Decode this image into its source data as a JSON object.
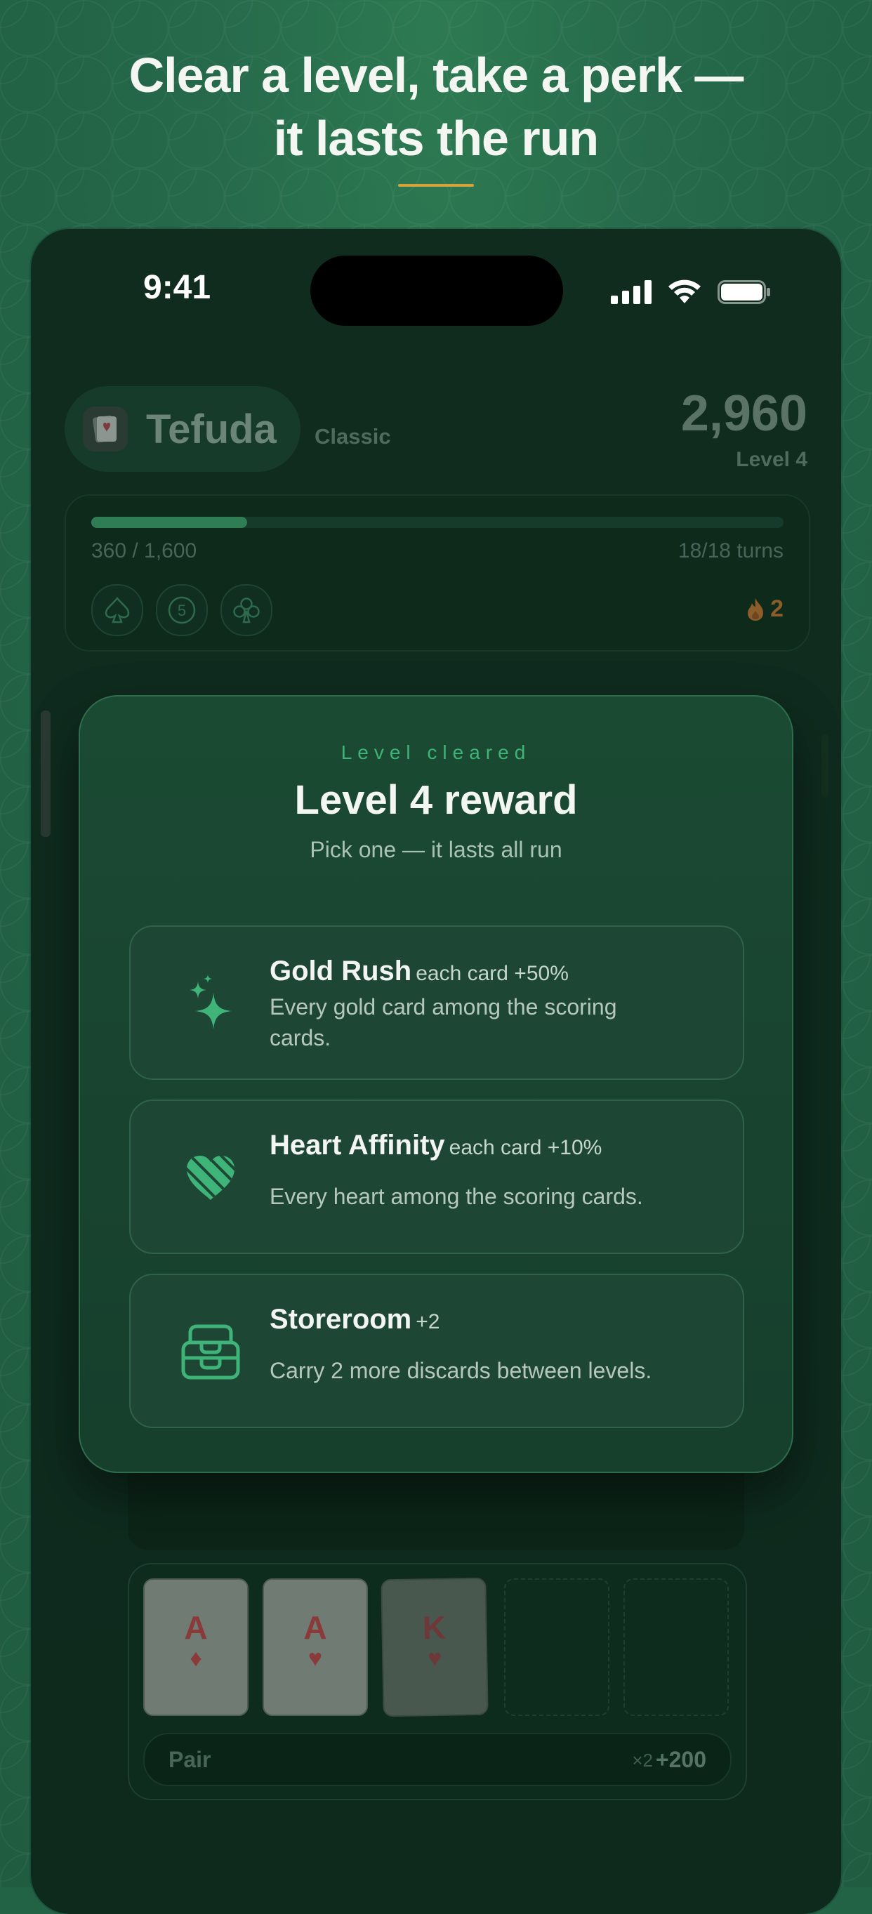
{
  "headline": {
    "line1": "Clear a level, take a perk —",
    "line2": "it lasts the run",
    "accent_color": "#d7a23a"
  },
  "status_bar": {
    "time": "9:41",
    "icons": [
      "cellular-signal-icon",
      "wifi-icon",
      "battery-icon"
    ]
  },
  "game": {
    "app_name": "Tefuda",
    "mode": "Classic",
    "score": "2,960",
    "level": "Level 4",
    "progress": {
      "current": "360 / 1,600",
      "turns": "18/18 turns",
      "fraction": 0.225
    },
    "chips": [
      {
        "icon": "spade-icon",
        "label": ""
      },
      {
        "icon": "coin-icon",
        "label": "5"
      },
      {
        "icon": "club-icon",
        "label": ""
      }
    ],
    "streak": "2",
    "hand": {
      "cards": [
        {
          "rank": "A",
          "suit": "♦"
        },
        {
          "rank": "A",
          "suit": "♥"
        },
        {
          "rank": "K",
          "suit": "♥"
        }
      ],
      "empty_slots": 2,
      "name": "Pair",
      "multiplier": "×2",
      "points": "+200"
    }
  },
  "reward_modal": {
    "eyebrow": "Level cleared",
    "title": "Level 4 reward",
    "subtitle": "Pick one — it lasts all run",
    "accent_color": "#3fb478",
    "perks": [
      {
        "icon": "sparkles-icon",
        "name": "Gold Rush",
        "tag": "each card +50%",
        "description": "Every gold card among the scoring cards."
      },
      {
        "icon": "heart-icon",
        "name": "Heart Affinity",
        "tag": "each card +10%",
        "description": "Every heart among the scoring cards."
      },
      {
        "icon": "storage-box-icon",
        "name": "Storeroom",
        "tag": "+2",
        "description": "Carry 2 more discards between levels."
      }
    ]
  }
}
